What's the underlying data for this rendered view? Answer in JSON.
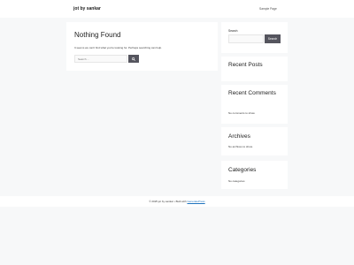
{
  "header": {
    "site_title": "jot by sankar",
    "nav_item": "Sample Page"
  },
  "main": {
    "title": "Nothing Found",
    "message": "It seems we can't find what you're looking for. Perhaps searching can help.",
    "search_placeholder": "Search …",
    "search_icon": "magnifier-icon"
  },
  "sidebar": {
    "search_label": "Search",
    "search_button": "Search",
    "recent_posts_title": "Recent Posts",
    "recent_comments_title": "Recent Comments",
    "recent_comments_empty": "No comments to show.",
    "archives_title": "Archives",
    "archives_empty": "No archives to show.",
    "categories_title": "Categories",
    "categories_empty": "No categories"
  },
  "footer": {
    "copyright": "© 2025 jot by sankar • Built with",
    "theme_link": "GeneratePress"
  },
  "colors": {
    "background": "#f7f8f9",
    "card": "#ffffff",
    "button": "#55555e",
    "link": "#1e73be"
  }
}
